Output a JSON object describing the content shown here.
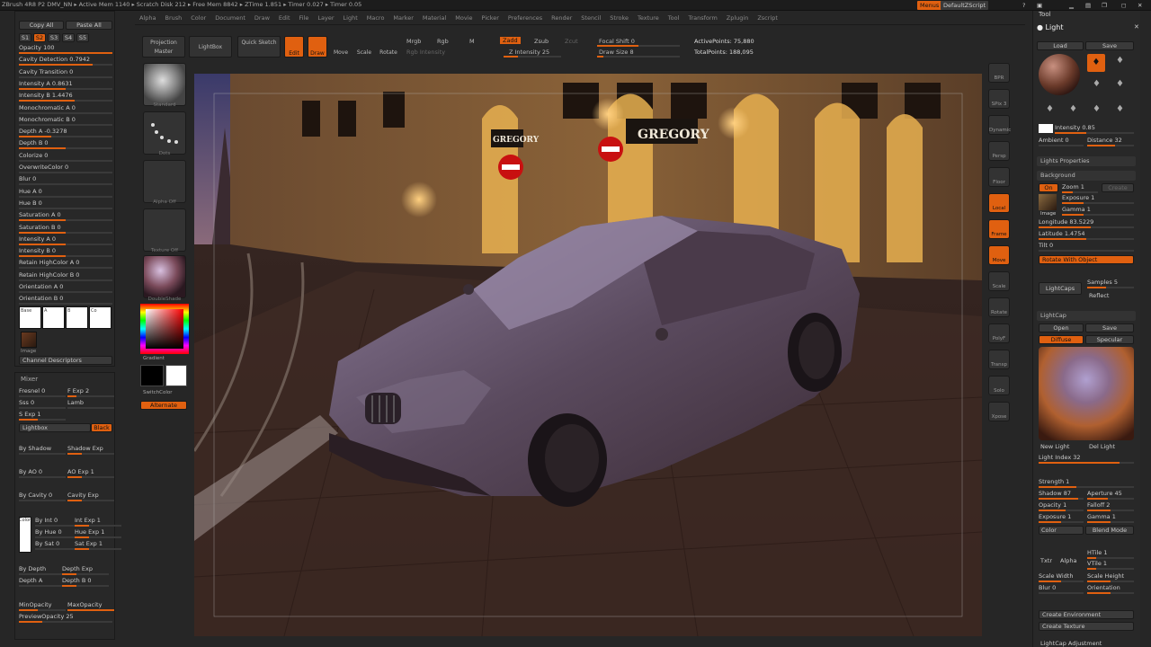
{
  "topbar": {
    "status": "ZBrush 4R8 P2   DMV_NN  ▸ Active Mem 1140 ▸ Scratch Disk 212 ▸ Free Mem 8842 ▸ ZTime 1.851 ▸ Timer 0.027 ▸ Timer 0.05",
    "menus_button": "Menus",
    "script_button": "DefaultZScript"
  },
  "menubar": [
    "Alpha",
    "Brush",
    "Color",
    "Document",
    "Draw",
    "Edit",
    "File",
    "Layer",
    "Light",
    "Macro",
    "Marker",
    "Material",
    "Movie",
    "Picker",
    "Preferences",
    "Render",
    "Stencil",
    "Stroke",
    "Texture",
    "Tool",
    "Transform",
    "Zplugin",
    "Zscript"
  ],
  "left_palette": {
    "copy": "Copy All",
    "paste": "Paste All",
    "tabs": [
      "S1",
      "S2",
      "S3",
      "S4",
      "S5"
    ],
    "sliders": [
      {
        "label": "Opacity 100",
        "v": 1.0
      },
      {
        "label": "Cavity Detection 0.7942",
        "v": 0.79
      },
      {
        "label": "Cavity Transition 0",
        "v": 0.0
      },
      {
        "label": "Intensity A 0.8631",
        "v": 0.5
      },
      {
        "label": "Intensity B 1.4476",
        "v": 0.6
      },
      {
        "label": "Monochromatic A 0",
        "v": 0.0
      },
      {
        "label": "Monochromatic B 0",
        "v": 0.0
      },
      {
        "label": "Depth A -0.3278",
        "v": 0.35
      },
      {
        "label": "Depth B 0",
        "v": 0.5
      },
      {
        "label": "Colorize 0",
        "v": 0.0
      },
      {
        "label": "OverwriteColor 0",
        "v": 0.0
      },
      {
        "label": "Blur 0",
        "v": 0.0
      },
      {
        "label": "Hue A 0",
        "v": 0.0
      },
      {
        "label": "Hue B 0",
        "v": 0.0
      },
      {
        "label": "Saturation A 0",
        "v": 0.5
      },
      {
        "label": "Saturation B 0",
        "v": 0.5
      },
      {
        "label": "Intensity A 0",
        "v": 0.5
      },
      {
        "label": "Intensity B 0",
        "v": 0.5
      },
      {
        "label": "Retain HighColor A 0",
        "v": 0.0
      },
      {
        "label": "Retain HighColor B 0",
        "v": 0.0
      },
      {
        "label": "Orientation A 0",
        "v": 0.0
      },
      {
        "label": "Orientation B 0",
        "v": 0.0
      }
    ],
    "swatch_labels": [
      "Base",
      "A",
      "B",
      "Co"
    ],
    "image_label": "Image",
    "channel_descriptors": "Channel Descriptors"
  },
  "mixer": {
    "title": "Mixer",
    "rows": [
      [
        {
          "label": "Fresnel 0",
          "v": 0.0
        },
        {
          "label": "F Exp 2",
          "v": 0.2
        }
      ],
      [
        {
          "label": "Sss 0",
          "v": 0.0
        },
        {
          "label": "Lamb",
          "v": 0.0
        }
      ],
      [
        {
          "label": "S Exp 1",
          "v": 0.4
        },
        {
          "label": "",
          "v": 0
        }
      ]
    ],
    "lighting_label": "Lightbox",
    "black_label": "Black",
    "pairs": [
      [
        {
          "label": "By Shadow",
          "v": 0.0
        },
        {
          "label": "Shadow Exp",
          "v": 0.3
        }
      ],
      [
        {
          "label": "By AO 0",
          "v": 0.0
        },
        {
          "label": "AO Exp 1",
          "v": 0.3
        }
      ],
      [
        {
          "label": "By Cavity 0",
          "v": 0.0
        },
        {
          "label": "Cavity Exp",
          "v": 0.3
        }
      ]
    ],
    "color_label": "Color",
    "hue_rows": [
      [
        {
          "label": "By Int 0",
          "v": 0.0
        },
        {
          "label": "Int Exp 1",
          "v": 0.3
        }
      ],
      [
        {
          "label": "By Hue 0",
          "v": 0.0
        },
        {
          "label": "Hue Exp 1",
          "v": 0.3
        }
      ],
      [
        {
          "label": "By Sat 0",
          "v": 0.0
        },
        {
          "label": "Sat Exp 1",
          "v": 0.3
        }
      ]
    ],
    "depth_rows": [
      [
        {
          "label": "By Depth",
          "v": 0.0
        },
        {
          "label": "Depth Exp",
          "v": 0.3
        }
      ],
      [
        {
          "label": "Depth A",
          "v": 0.0
        },
        {
          "label": "Depth B 0",
          "v": 0.3
        }
      ]
    ],
    "min_opacity": "MinOpacity",
    "max_opacity": "MaxOpacity",
    "preview_opacity": "PreviewOpacity 25"
  },
  "brushes": {
    "labels": [
      "Standard",
      "Dots",
      "Alpha Off",
      "Texture Off",
      "DoubleShade"
    ],
    "gradient": "Gradient",
    "switch_color": "SwitchColor",
    "alternate": "Alternate"
  },
  "toolbar": {
    "projection_master": "Projection Master",
    "lightbox": "LightBox",
    "quick_sketch": "Quick Sketch",
    "edit": "Edit",
    "draw": "Draw",
    "move": "Move",
    "scale": "Scale",
    "rotate": "Rotate",
    "mrgb": "Mrgb",
    "rgb": "Rgb",
    "m": "M",
    "zadd": "Zadd",
    "zsub": "Zsub",
    "zcut": "Zcut",
    "rgb_intensity": "Rgb Intensity",
    "z_intensity": "Z Intensity 25",
    "focal_shift": "Focal Shift 0",
    "draw_size": "Draw Size 8",
    "active_points": "ActivePoints: 75,880",
    "total_points": "TotalPoints: 188,095"
  },
  "shelf": [
    "BPR",
    "SPix 3",
    "Dynamic",
    "Persp",
    "Floor",
    "Local",
    "Frame",
    "Move",
    "Scale",
    "Rotate",
    "PolyF",
    "Transp",
    "Solo",
    "Xpose"
  ],
  "right_palette": {
    "tool_label": "Tool",
    "title": "Light",
    "load": "Load",
    "save": "Save",
    "intensity": "Intensity 0.85",
    "ambient": "Ambient 0",
    "distance": "Distance 32",
    "lights_properties": "Lights Properties",
    "background": "Background",
    "on": "On",
    "zoom": "Zoom 1",
    "create": "Create",
    "exposure": "Exposure 1",
    "gamma": "Gamma 1",
    "image": "Image",
    "longitude": "Longitude 83.5229",
    "latitude": "Latitude 1.4754",
    "tilt": "Tilt 0",
    "rotate_with_object": "Rotate With Object",
    "lightcaps": "LightCaps",
    "samples": "Samples 5",
    "reflect": "Reflect",
    "lightcap": "LightCap",
    "open": "Open",
    "save2": "Save",
    "diffuse": "Diffuse",
    "specular": "Specular",
    "new_light": "New Light",
    "del_light": "Del Light",
    "light_index": "Light Index 32",
    "strength": "Strength 1",
    "shadow": "Shadow 87",
    "aperture": "Aperture 45",
    "opacity": "Opacity 1",
    "falloff": "Falloff 2",
    "exposure2": "Exposure 1",
    "gamma2": "Gamma 1",
    "color": "Color",
    "blend_mode": "Blend Mode",
    "htile": "HTile 1",
    "vtile": "VTile 1",
    "txtr": "Txtr",
    "alpha": "Alpha",
    "scale_width": "Scale Width",
    "scale_height": "Scale Height",
    "blur": "Blur 0",
    "orientation": "Orientation",
    "create_environment": "Create Environment",
    "create_texture": "Create Texture",
    "lightcap_adjust": "LightCap Adjustment"
  },
  "colors": {
    "accent": "#e06010",
    "panel": "#282828",
    "bg": "#262626"
  },
  "viewport": {
    "shop1": "GREGORY",
    "shop2": "GREGORY"
  }
}
